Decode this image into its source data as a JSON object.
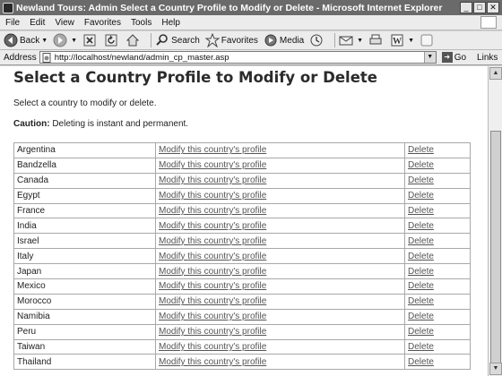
{
  "window": {
    "title": "Newland Tours: Admin Select a Country Profile to Modify or Delete - Microsoft Internet Explorer",
    "minimize_glyph": "_",
    "maximize_glyph": "□",
    "close_glyph": "✕"
  },
  "menu": [
    "File",
    "Edit",
    "View",
    "Favorites",
    "Tools",
    "Help"
  ],
  "toolbar": {
    "back_label": "Back",
    "search_label": "Search",
    "favorites_label": "Favorites",
    "media_label": "Media"
  },
  "address": {
    "label": "Address",
    "url": "http://localhost/newland/admin_cp_master.asp",
    "go_label": "Go",
    "links_label": "Links"
  },
  "page": {
    "title": "Select a Country Profile to Modify or Delete",
    "instructions": "Select a country to modify or delete.",
    "caution_label": "Caution:",
    "caution_text": " Deleting is instant and permanent.",
    "modify_link_label": "Modify this country's profile",
    "delete_link_label": "Delete"
  },
  "countries": [
    "Argentina",
    "Bandzella",
    "Canada",
    "Egypt",
    "France",
    "India",
    "Israel",
    "Italy",
    "Japan",
    "Mexico",
    "Morocco",
    "Namibia",
    "Peru",
    "Taiwan",
    "Thailand"
  ],
  "icons": {
    "back": "back-arrow-icon",
    "forward": "forward-arrow-icon",
    "stop": "stop-icon",
    "refresh": "refresh-icon",
    "home": "home-icon",
    "search": "search-icon",
    "favorites": "favorites-star-icon",
    "media": "media-icon",
    "history": "history-icon",
    "mail": "mail-icon",
    "print": "print-icon",
    "edit": "edit-icon",
    "discuss": "discuss-icon"
  }
}
